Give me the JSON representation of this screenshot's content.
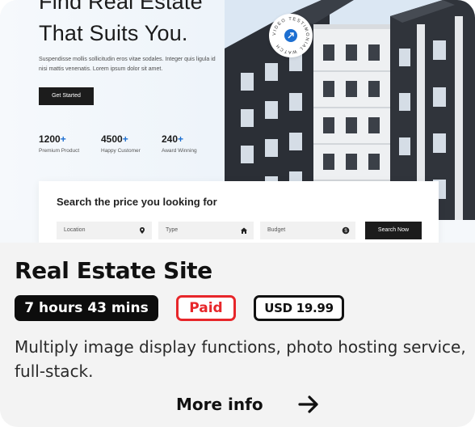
{
  "preview": {
    "hero_title_line1": "Find Real Estate",
    "hero_title_line2": "That Suits You.",
    "hero_description": "Suspendisse mollis sollicitudin eros vitae sodales. Integer quis ligula id nisi mattis venenatis. Lorem ipsum dolor sit amet.",
    "get_started_label": "Get Started",
    "stats": [
      {
        "value": "1200",
        "suffix": "+",
        "label": "Premium Product"
      },
      {
        "value": "4500",
        "suffix": "+",
        "label": "Happy Customer"
      },
      {
        "value": "240",
        "suffix": "+",
        "label": "Award Winning"
      }
    ],
    "video_badge_text": "VIDEO TESTIMONIAL WATCH",
    "search": {
      "title": "Search the price you looking for",
      "location_placeholder": "Location",
      "type_placeholder": "Type",
      "budget_placeholder": "Budget",
      "search_button": "Search Now"
    },
    "accent_color": "#1d6fd1"
  },
  "card": {
    "title": "Real Estate Site",
    "duration": "7 hours 43 mins",
    "pricing_type": "Paid",
    "price": "USD 19.99",
    "description": "Multiply image display functions, photo hosting service, full-stack.",
    "more_info_label": "More info",
    "paid_color": "#e7262a"
  },
  "icons": [
    "location-pin-icon",
    "home-icon",
    "dollar-icon",
    "play-arrow-icon",
    "arrow-right-icon"
  ]
}
